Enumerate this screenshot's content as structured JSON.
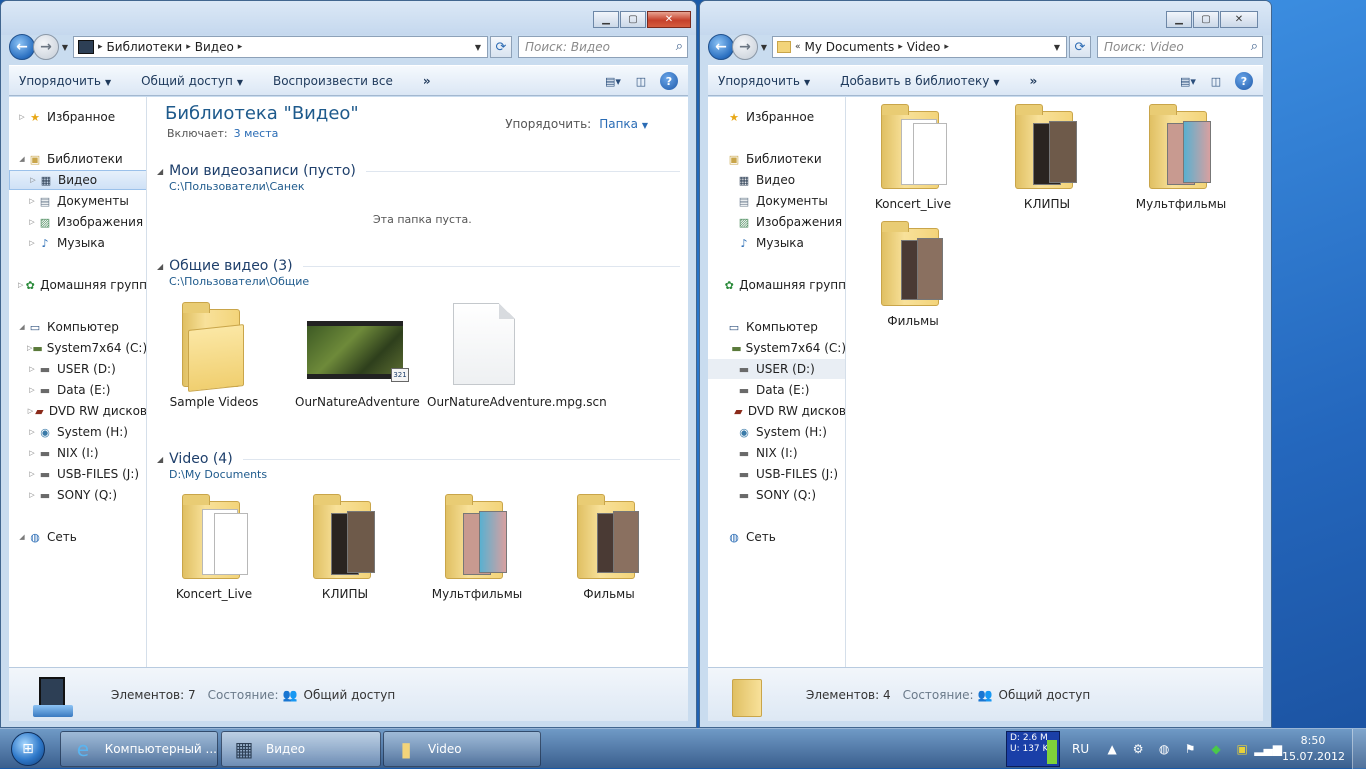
{
  "left_window": {
    "address": {
      "crumbs": [
        "Библиотеки",
        "Видео"
      ]
    },
    "search_placeholder": "Поиск: Видео",
    "commands": [
      {
        "label": "Упорядочить",
        "dropdown": true
      },
      {
        "label": "Общий доступ",
        "dropdown": true
      },
      {
        "label": "Воспроизвести все",
        "dropdown": false
      }
    ],
    "more": "»",
    "nav": {
      "favorites": "Избранное",
      "libraries": "Библиотеки",
      "lib_items": [
        "Видео",
        "Документы",
        "Изображения",
        "Музыка"
      ],
      "homegroup": "Домашняя групп",
      "computer": "Компьютер",
      "drives": [
        "System7x64 (C:)",
        "USER (D:)",
        "Data (E:)",
        "DVD RW дисков",
        "System (H:)",
        "NIX (I:)",
        "USB-FILES (J:)",
        "SONY (Q:)"
      ],
      "network": "Сеть"
    },
    "library": {
      "title": "Библиотека \"Видео\"",
      "includes_label": "Включает:",
      "includes_link": "3 места",
      "arrange_label": "Упорядочить:",
      "arrange_value": "Папка"
    },
    "groups": [
      {
        "title": "Мои видеозаписи (пусто)",
        "path": "C:\\Пользователи\\Санек",
        "empty_text": "Эта папка пуста."
      },
      {
        "title": "Общие видео (3)",
        "path": "C:\\Пользователи\\Общие",
        "items": [
          "Sample Videos",
          "OurNatureAdventure",
          "OurNatureAdventure.mpg.scn"
        ]
      },
      {
        "title": "Video (4)",
        "path": "D:\\My Documents",
        "items": [
          "Koncert_Live",
          "КЛИПЫ",
          "Мультфильмы",
          "Фильмы"
        ]
      }
    ],
    "status": {
      "count": "Элементов: 7",
      "state_label": "Состояние:",
      "state_value": "Общий доступ"
    }
  },
  "right_window": {
    "address": {
      "crumbs": [
        "My Documents",
        "Video"
      ],
      "prefix": "«"
    },
    "search_placeholder": "Поиск: Video",
    "commands": [
      {
        "label": "Упорядочить",
        "dropdown": true
      },
      {
        "label": "Добавить в библиотеку",
        "dropdown": true
      }
    ],
    "more": "»",
    "nav": {
      "favorites": "Избранное",
      "libraries": "Библиотеки",
      "lib_items": [
        "Видео",
        "Документы",
        "Изображения",
        "Музыка"
      ],
      "homegroup": "Домашняя групп",
      "computer": "Компьютер",
      "drives": [
        "System7x64 (C:)",
        "USER (D:)",
        "Data (E:)",
        "DVD RW дисков",
        "System (H:)",
        "NIX (I:)",
        "USB-FILES (J:)",
        "SONY (Q:)"
      ],
      "network": "Сеть"
    },
    "items": [
      "Koncert_Live",
      "КЛИПЫ",
      "Мультфильмы",
      "Фильмы"
    ],
    "status": {
      "count": "Элементов: 4",
      "state_label": "Состояние:",
      "state_value": "Общий доступ"
    }
  },
  "taskbar": {
    "buttons": [
      "Компьютерный ...",
      "Видео",
      "Video"
    ],
    "netmon": {
      "down": "D: 2.6 M",
      "up": "U: 137 K"
    },
    "lang": "RU",
    "time": "8:50",
    "date": "15.07.2012"
  },
  "colors": {
    "accent": "#1e5a8c",
    "link": "#2a6cb5",
    "folder": "#f3d47a"
  }
}
